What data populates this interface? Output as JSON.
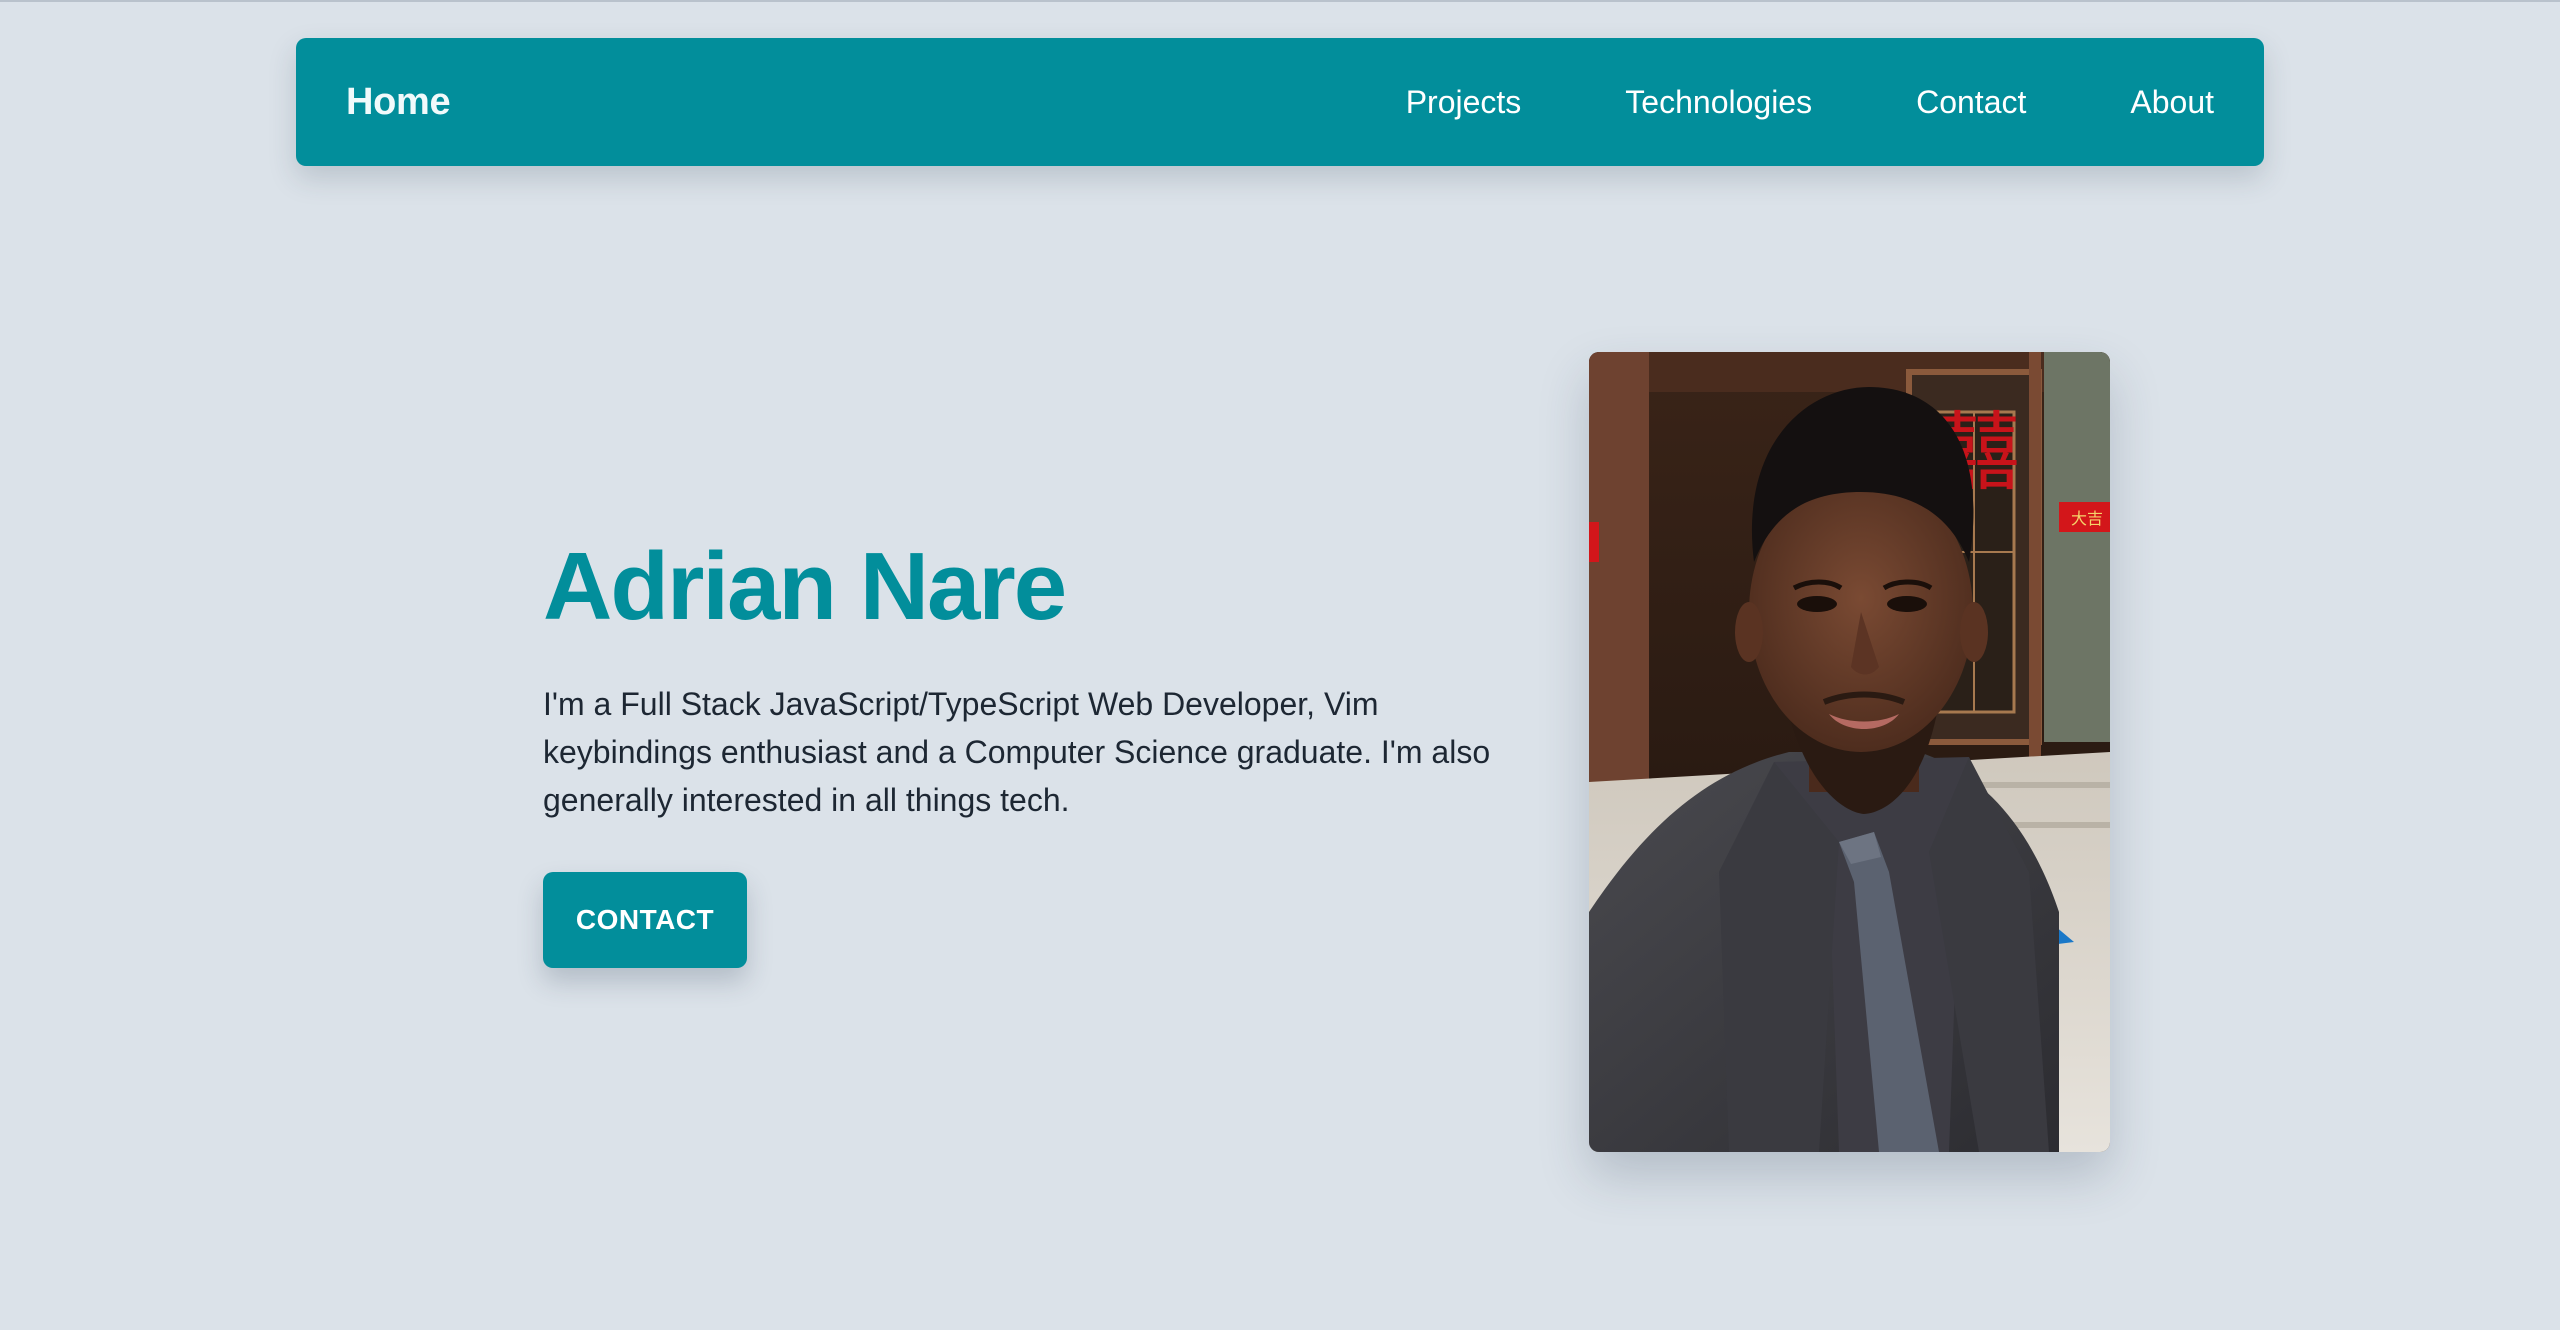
{
  "navbar": {
    "home_label": "Home",
    "links": [
      {
        "label": "Projects"
      },
      {
        "label": "Technologies"
      },
      {
        "label": "Contact"
      },
      {
        "label": "About"
      }
    ],
    "accent_color": "#028e9b"
  },
  "hero": {
    "name": "Adrian Nare",
    "bio": "I'm a Full Stack JavaScript/TypeScript Web Developer, Vim keybindings enthusiast and a Computer Science graduate. I'm also generally interested in all things tech.",
    "contact_button_label": "CONTACT",
    "portrait_icon": "portrait-photo",
    "sign_glyph": "囍",
    "banner_text": "大吉"
  },
  "colors": {
    "background": "#dbe2e9",
    "accent": "#028e9b",
    "text": "#1d2733"
  }
}
